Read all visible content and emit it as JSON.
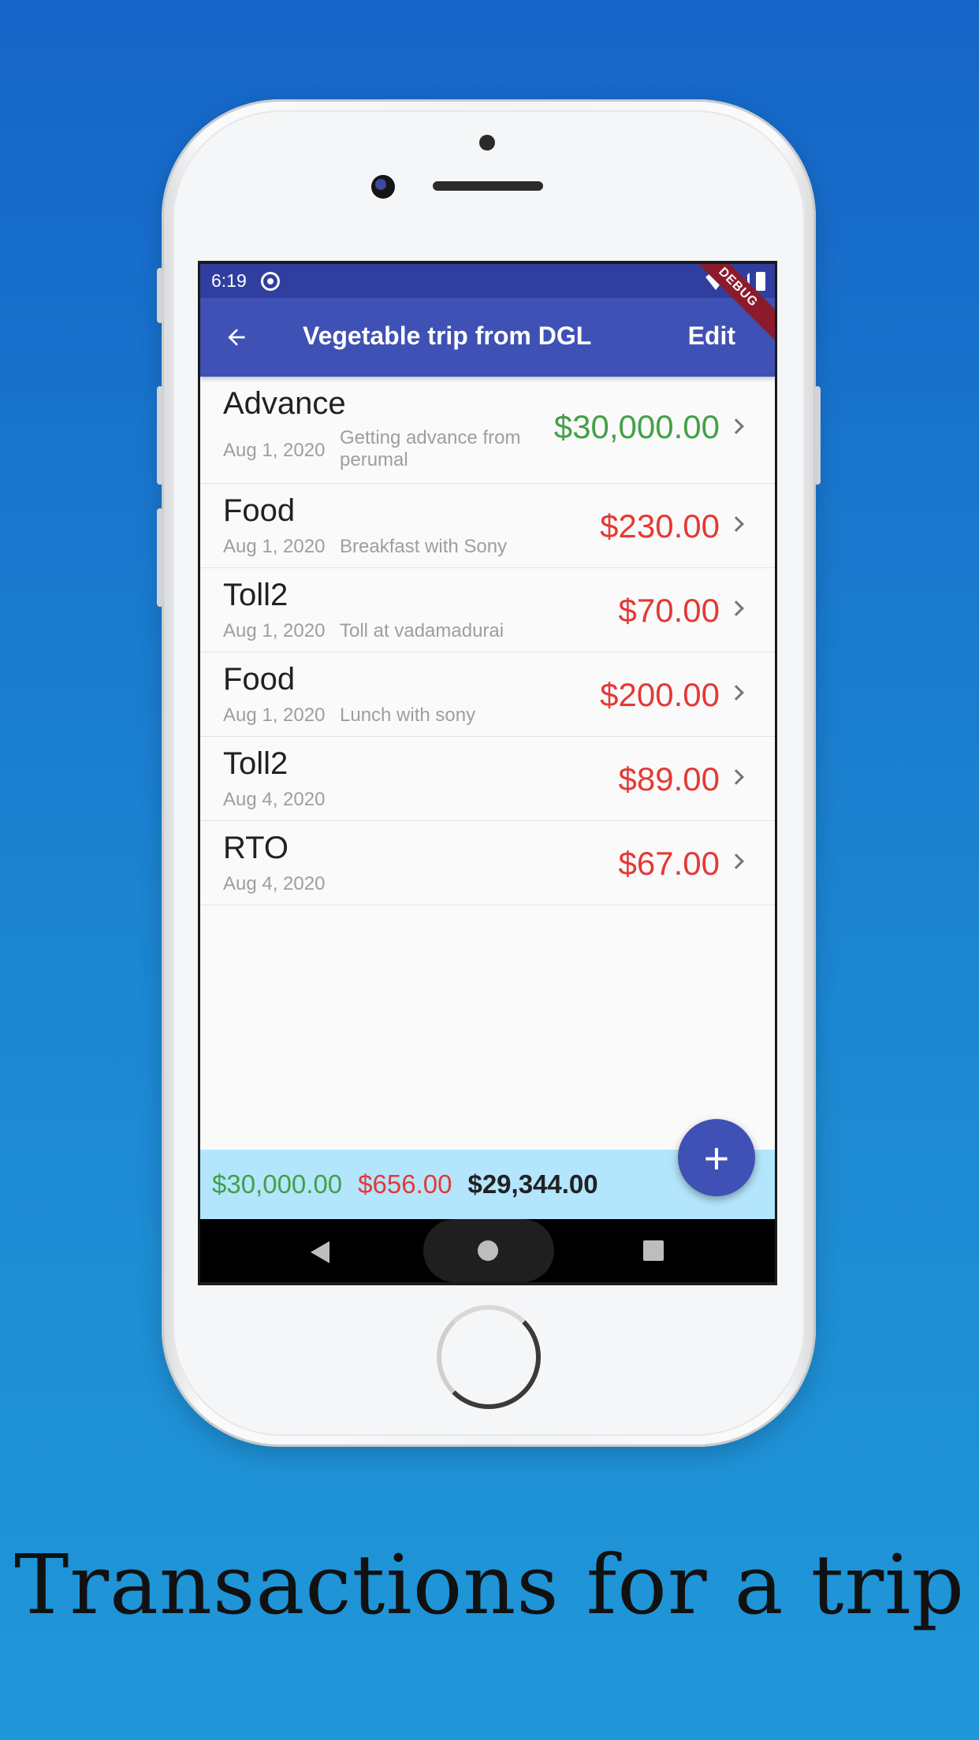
{
  "status_bar": {
    "time": "6:19"
  },
  "debug_ribbon": "DEBUG",
  "app_bar": {
    "title": "Vegetable trip from DGL",
    "edit_label": "Edit"
  },
  "colors": {
    "income": "#43a047",
    "expense": "#e53935",
    "primary": "#3f51b5"
  },
  "transactions": [
    {
      "title": "Advance",
      "date": "Aug 1, 2020",
      "description": "Getting advance from perumal",
      "amount": "$30,000.00",
      "type": "income"
    },
    {
      "title": "Food",
      "date": "Aug 1, 2020",
      "description": "Breakfast with Sony",
      "amount": "$230.00",
      "type": "expense"
    },
    {
      "title": "Toll2",
      "date": "Aug 1, 2020",
      "description": "Toll at vadamadurai",
      "amount": "$70.00",
      "type": "expense"
    },
    {
      "title": "Food",
      "date": "Aug 1, 2020",
      "description": "Lunch with sony",
      "amount": "$200.00",
      "type": "expense"
    },
    {
      "title": "Toll2",
      "date": "Aug 4, 2020",
      "description": "",
      "amount": "$89.00",
      "type": "expense"
    },
    {
      "title": "RTO",
      "date": "Aug 4, 2020",
      "description": "",
      "amount": "$67.00",
      "type": "expense"
    }
  ],
  "summary": {
    "income": "$30,000.00",
    "expense": "$656.00",
    "balance": "$29,344.00"
  },
  "fab_label": "+",
  "caption": "Transactions for a trip"
}
